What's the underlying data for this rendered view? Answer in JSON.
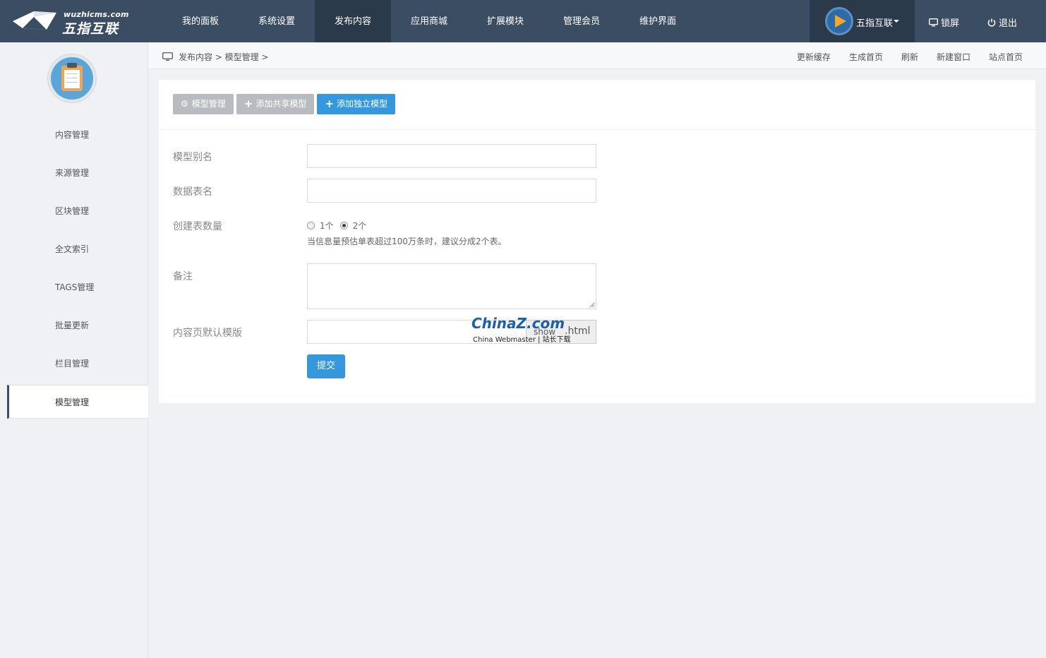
{
  "header": {
    "logo_url": "wuzhicms.com",
    "logo_text": "五指互联",
    "nav": [
      "我的面板",
      "系统设置",
      "发布内容",
      "应用商城",
      "扩展模块",
      "管理会员",
      "维护界面"
    ],
    "active_nav": "发布内容",
    "user_name": "五指互联",
    "lock_label": "锁屏",
    "logout_label": "退出"
  },
  "sidebar": {
    "items": [
      "内容管理",
      "来源管理",
      "区块管理",
      "全文索引",
      "TAGS管理",
      "批量更新",
      "栏目管理",
      "模型管理"
    ],
    "active_item": "模型管理"
  },
  "breadcrumb": {
    "path": "发布内容 > 模型管理 >",
    "links": [
      "更新缓存",
      "生成首页",
      "刷新",
      "新建窗口",
      "站点首页"
    ]
  },
  "toolbar": {
    "model_manage": "模型管理",
    "add_shared": "添加共享模型",
    "add_independent": "添加独立模型"
  },
  "form": {
    "alias_label": "模型别名",
    "alias_value": "",
    "table_label": "数据表名",
    "table_value": "",
    "count_label": "创建表数量",
    "count_options": [
      "1个",
      "2个"
    ],
    "count_selected": "2个",
    "count_hint": "当信息量预估单表超过100万条时，建议分成2个表。",
    "remark_label": "备注",
    "remark_value": "",
    "template_label": "内容页默认模版",
    "template_value": "",
    "template_addon_a": "show",
    "template_addon_b": ".html",
    "submit_label": "提交"
  },
  "watermark": {
    "brand": "ChinaZ.com",
    "sub": "China Webmaster | 站长下载"
  },
  "colors": {
    "header_bg": "#3a4d62",
    "header_active": "#2b3a4b",
    "primary": "#3598dc",
    "muted_button": "#b8bcc1"
  }
}
